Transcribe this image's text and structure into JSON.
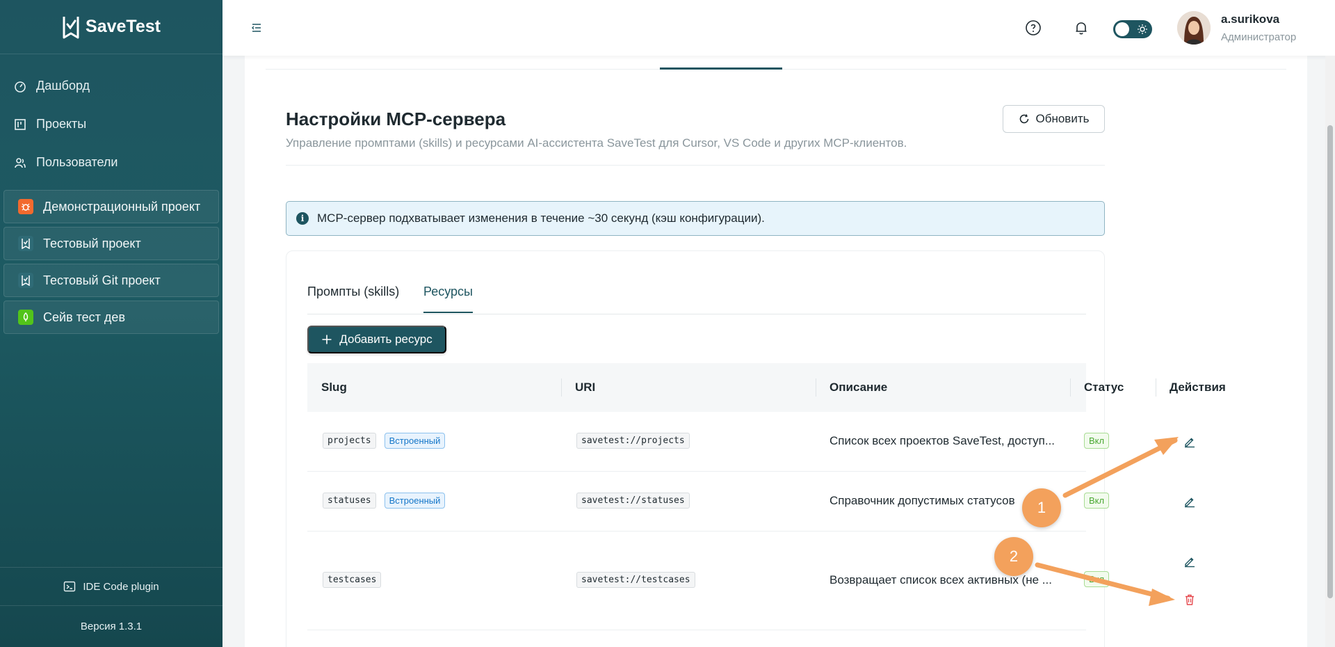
{
  "app": {
    "name": "SaveTest",
    "version": "Версия 1.3.1",
    "plugin_label": "IDE Code plugin"
  },
  "sidebar": {
    "nav": [
      {
        "label": "Дашборд",
        "icon": "dashboard-icon"
      },
      {
        "label": "Проекты",
        "icon": "kanban-icon"
      },
      {
        "label": "Пользователи",
        "icon": "users-icon"
      }
    ],
    "projects": [
      {
        "label": "Демонстрационный проект",
        "icon": "bug-icon",
        "color": "#f26a2e"
      },
      {
        "label": "Тестовый проект",
        "icon": "savetest-icon",
        "color": "#2f6b76"
      },
      {
        "label": "Тестовый Git проект",
        "icon": "savetest-icon",
        "color": "#2f6b76"
      },
      {
        "label": "Сейв тест дев",
        "icon": "rocket-icon",
        "color": "#52c41a"
      }
    ]
  },
  "header": {
    "user_name": "a.surikova",
    "user_role": "Администратор"
  },
  "page": {
    "title": "Настройки MCP-сервера",
    "subtitle": "Управление промптами (skills) и ресурсами AI-ассистента SaveTest для Cursor, VS Code и других MCP-клиентов.",
    "refresh_label": "Обновить",
    "alert": "MCP-сервер подхватывает изменения в течение ~30 секунд (кэш конфигурации).",
    "tabs": [
      {
        "label": "Промпты (skills)",
        "active": false
      },
      {
        "label": "Ресурсы",
        "active": true
      }
    ],
    "add_label": "Добавить ресурс",
    "columns": [
      "Slug",
      "URI",
      "Описание",
      "Статус",
      "Действия"
    ],
    "rows": [
      {
        "slug": "projects",
        "badge": "Встроенный",
        "uri": "savetest://projects",
        "description": "Список всех проектов SaveTest, доступ...",
        "status": "Вкл"
      },
      {
        "slug": "statuses",
        "badge": "Встроенный",
        "uri": "savetest://statuses",
        "description": "Справочник допустимых статусов",
        "status": "Вкл"
      },
      {
        "slug": "testcases",
        "badge": "",
        "uri": "savetest://testcases",
        "description": "Возвращает список всех активных (не ...",
        "status": "Вкл"
      }
    ]
  },
  "annotations": {
    "marker1": "1",
    "marker2": "2",
    "accent_color": "#f3a15c"
  },
  "colors": {
    "primary": "#1e5560",
    "danger": "#e5484d",
    "info_bg": "#e7f4fb"
  }
}
